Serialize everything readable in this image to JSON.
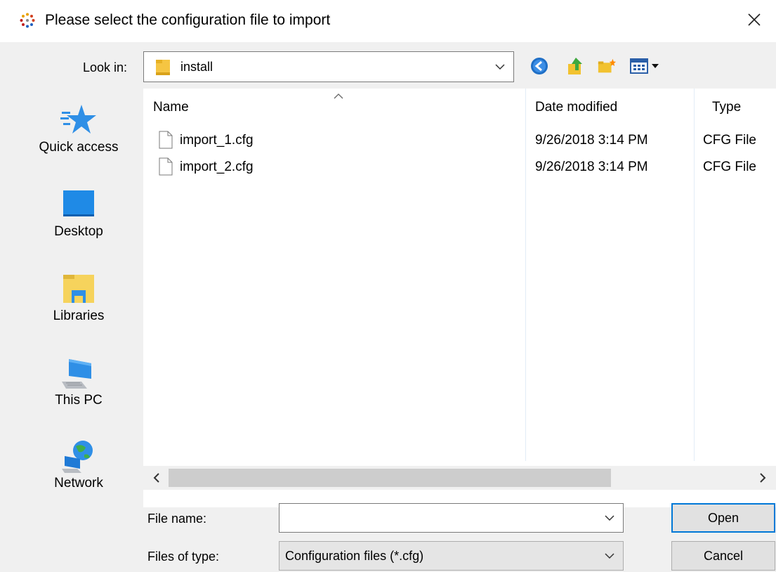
{
  "title": "Please select the configuration file to import",
  "toolbar": {
    "look_in_label": "Look in:",
    "look_in_value": "install"
  },
  "places": [
    {
      "label": "Quick access",
      "icon": "star-icon"
    },
    {
      "label": "Desktop",
      "icon": "desktop-icon"
    },
    {
      "label": "Libraries",
      "icon": "libraries-icon"
    },
    {
      "label": "This PC",
      "icon": "computer-icon"
    },
    {
      "label": "Network",
      "icon": "network-icon"
    }
  ],
  "columns": {
    "name": "Name",
    "date": "Date modified",
    "type": "Type"
  },
  "files": [
    {
      "name": "import_1.cfg",
      "date": "9/26/2018 3:14 PM",
      "type": "CFG File"
    },
    {
      "name": "import_2.cfg",
      "date": "9/26/2018 3:14 PM",
      "type": "CFG File"
    }
  ],
  "footer": {
    "file_name_label": "File name:",
    "file_name_value": "",
    "file_type_label": "Files of type:",
    "file_type_value": "Configuration files (*.cfg)",
    "open_label": "Open",
    "cancel_label": "Cancel"
  },
  "colors": {
    "accent": "#0078d7",
    "dialog_bg": "#f0f0f0"
  }
}
